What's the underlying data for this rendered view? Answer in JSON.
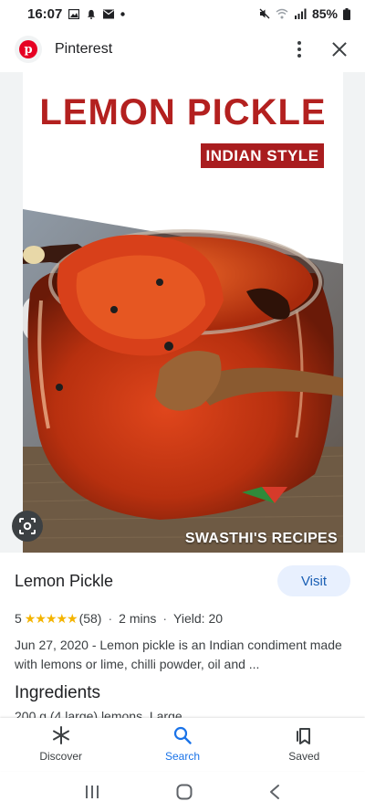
{
  "status": {
    "time": "16:07",
    "battery": "85%",
    "left_icons": [
      "image-icon",
      "bell-icon",
      "mail-icon",
      "dot-icon"
    ],
    "right_icons": [
      "mute-icon",
      "wifi-icon",
      "signal-icon",
      "battery-icon"
    ]
  },
  "header": {
    "site_name": "Pinterest",
    "logo_letter": "p"
  },
  "image": {
    "title": "LEMON PICKLE",
    "subtitle": "INDIAN STYLE",
    "watermark": "SWASTHI'S RECIPES"
  },
  "result": {
    "title": "Lemon Pickle",
    "visit_label": "Visit",
    "rating": "5",
    "stars": "★★★★★",
    "reviews": "(58)",
    "time": "2 mins",
    "yield": "Yield: 20",
    "description": "Jun 27, 2020 - Lemon pickle is an Indian condiment made with lemons or lime, chilli powder, oil and ...",
    "ingredients_heading": "Ingredients",
    "ingredient_line": "200 g (4 large) lemons, Large"
  },
  "bottom_nav": [
    {
      "label": "Discover",
      "icon": "asterisk-icon",
      "active": false
    },
    {
      "label": "Search",
      "icon": "search-icon",
      "active": true
    },
    {
      "label": "Saved",
      "icon": "bookmarks-icon",
      "active": false
    }
  ],
  "colors": {
    "accent": "#1a73e8",
    "title_red": "#b3201f",
    "pinterest_red": "#e60023",
    "visit_bg": "#e8f0fe"
  }
}
